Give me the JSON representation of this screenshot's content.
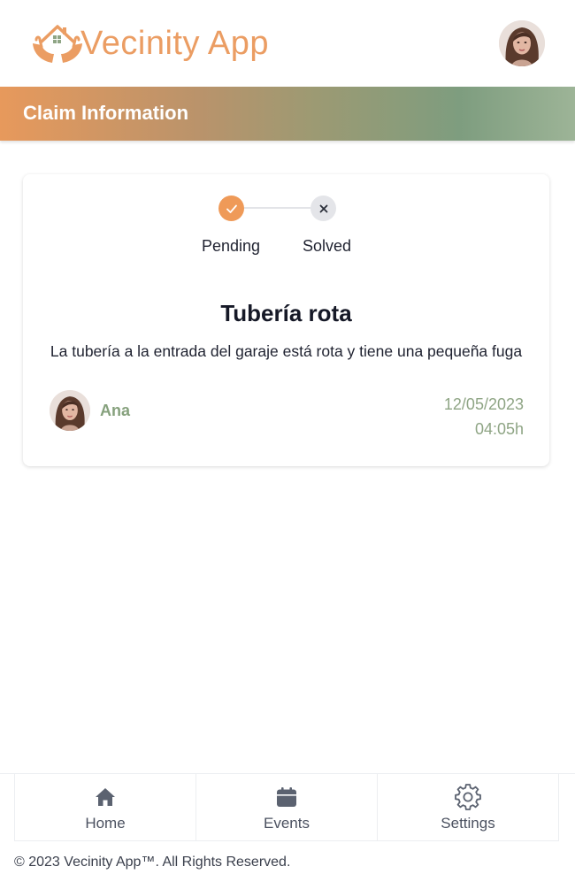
{
  "app": {
    "name": "Vecinity App",
    "logo_icon": "house-hands-icon",
    "brand_color": "#eb9d63"
  },
  "header": {
    "avatar_icon": "user-avatar"
  },
  "banner": {
    "title": "Claim Information"
  },
  "claim": {
    "steps": [
      {
        "label": "Pending",
        "state": "done",
        "icon": "check-icon"
      },
      {
        "label": "Solved",
        "state": "pending",
        "icon": "close-icon"
      }
    ],
    "title": "Tubería rota",
    "description": "La tubería a la entrada del garaje está rota y tiene una pequeña fuga",
    "author": "Ana",
    "date": "12/05/2023",
    "time": "04:05h"
  },
  "nav": {
    "items": [
      {
        "label": "Home",
        "icon": "home-icon"
      },
      {
        "label": "Events",
        "icon": "calendar-icon"
      },
      {
        "label": "Settings",
        "icon": "gear-icon"
      }
    ]
  },
  "footer": {
    "text": "© 2023 Vecinity App™. All Rights Reserved."
  }
}
